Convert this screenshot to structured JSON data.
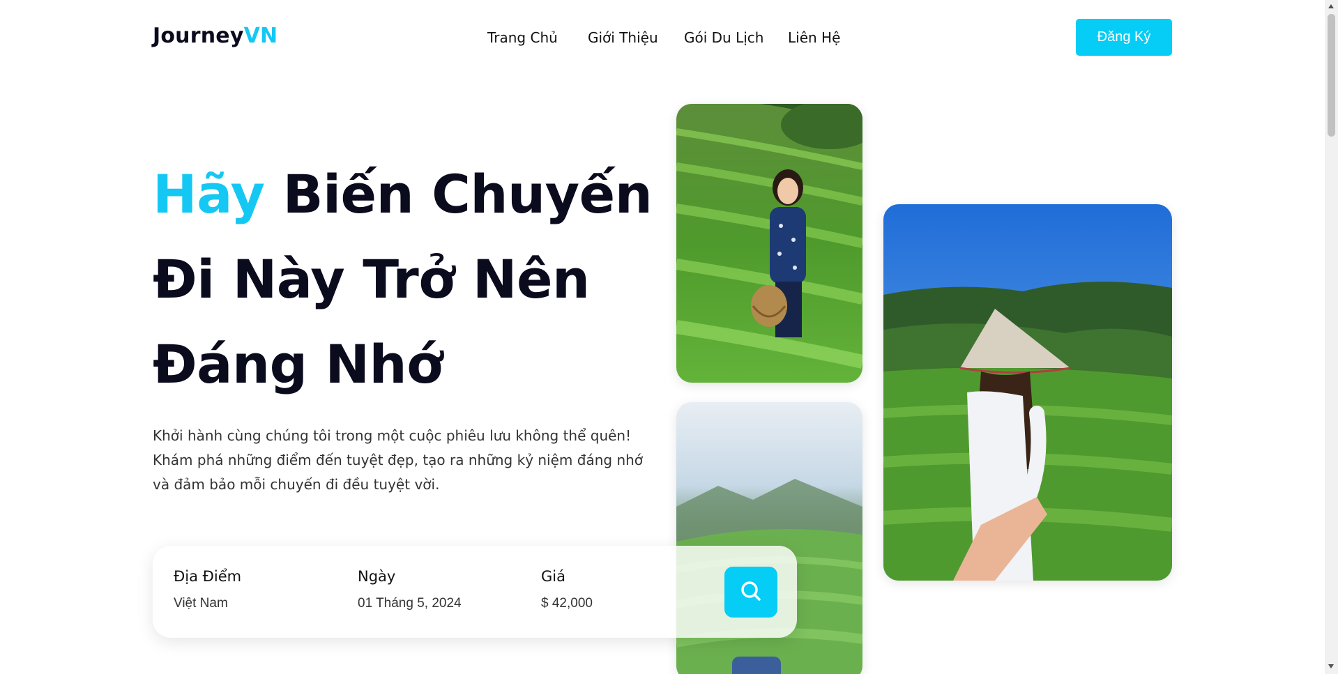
{
  "brand": {
    "part1": "Journey",
    "part2": "VN"
  },
  "nav": [
    "Trang Chủ",
    "Giới Thiệu",
    "Gói Du Lịch",
    "Liên Hệ"
  ],
  "signup_label": "Đăng Ký",
  "hero": {
    "accent": "Hãy",
    "line1_rest": "Biến Chuyến",
    "line2": "Đi Này Trở Nên",
    "line3": "Đáng Nhớ"
  },
  "lead": [
    "Khởi hành cùng chúng tôi trong một cuộc phiêu lưu không thể quên!",
    "Khám phá những điểm đến tuyệt đẹp, tạo ra những kỷ niệm đáng nhớ",
    "và đảm bảo mỗi chuyến đi đều tuyệt vời."
  ],
  "search": {
    "location": {
      "label": "Địa Điểm",
      "value": "Việt Nam"
    },
    "date": {
      "label": "Ngày",
      "value": "01 Tháng 5, 2024"
    },
    "price": {
      "label": "Giá",
      "value": "$ 42,000"
    },
    "button_icon": "search-icon"
  },
  "photos": [
    "tea-plantation-woman-basket",
    "tea-hills-blurred",
    "woman-conical-hat-tea-field"
  ],
  "colors": {
    "accent": "#14c8f3",
    "button": "#06cdf5",
    "text": "#0b0b1e"
  }
}
